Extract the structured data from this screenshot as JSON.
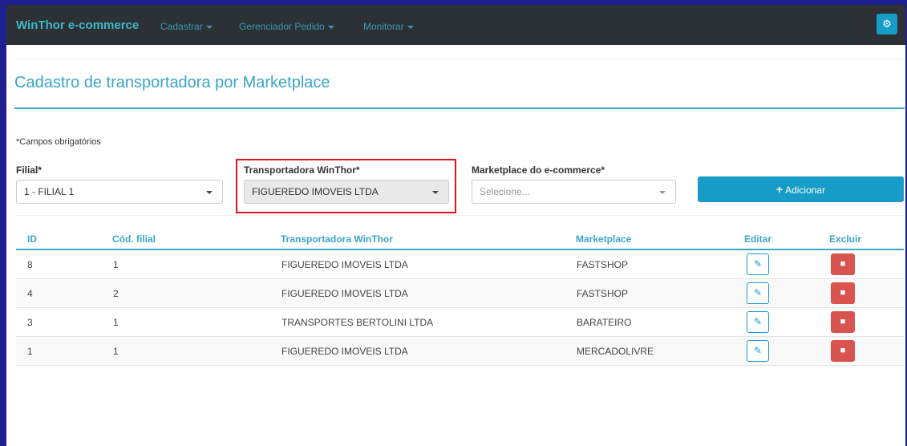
{
  "navbar": {
    "brand": "WinThor e-commerce",
    "menus": [
      {
        "label": "Cadastrar"
      },
      {
        "label": "Gerenciador Pedido"
      },
      {
        "label": "Monitorar"
      }
    ],
    "settings_icon": "gear-icon"
  },
  "page": {
    "title": "Cadastro de transportadora por Marketplace",
    "required_note": "*Campos obrigatórios"
  },
  "form": {
    "filial": {
      "label": "Filial*",
      "value": "1 - FILIAL 1"
    },
    "transportadora": {
      "label": "Transportadora WinThor*",
      "value": "FIGUEREDO IMOVEIS LTDA"
    },
    "marketplace": {
      "label": "Marketplace do e-commerce*",
      "placeholder": "Selecione..."
    },
    "add_button": "Adicionar"
  },
  "table": {
    "headers": [
      "ID",
      "Cód. filial",
      "Transportadora WinThor",
      "Marketplace",
      "Editar",
      "Excluir"
    ],
    "rows": [
      {
        "id": "8",
        "filial": "1",
        "transportadora": "FIGUEREDO IMOVEIS LTDA",
        "marketplace": "FASTSHOP"
      },
      {
        "id": "4",
        "filial": "2",
        "transportadora": "FIGUEREDO IMOVEIS LTDA",
        "marketplace": "FASTSHOP"
      },
      {
        "id": "3",
        "filial": "1",
        "transportadora": "TRANSPORTES BERTOLINI LTDA",
        "marketplace": "BARATEIRO"
      },
      {
        "id": "1",
        "filial": "1",
        "transportadora": "FIGUEREDO IMOVEIS LTDA",
        "marketplace": "MERCADOLIVRE"
      }
    ]
  },
  "colors": {
    "navbar_bg": "#2b3135",
    "accent": "#3aa6c6",
    "primary_button": "#169cc7",
    "danger_button": "#d9534f",
    "highlight_border": "#e0141b"
  }
}
